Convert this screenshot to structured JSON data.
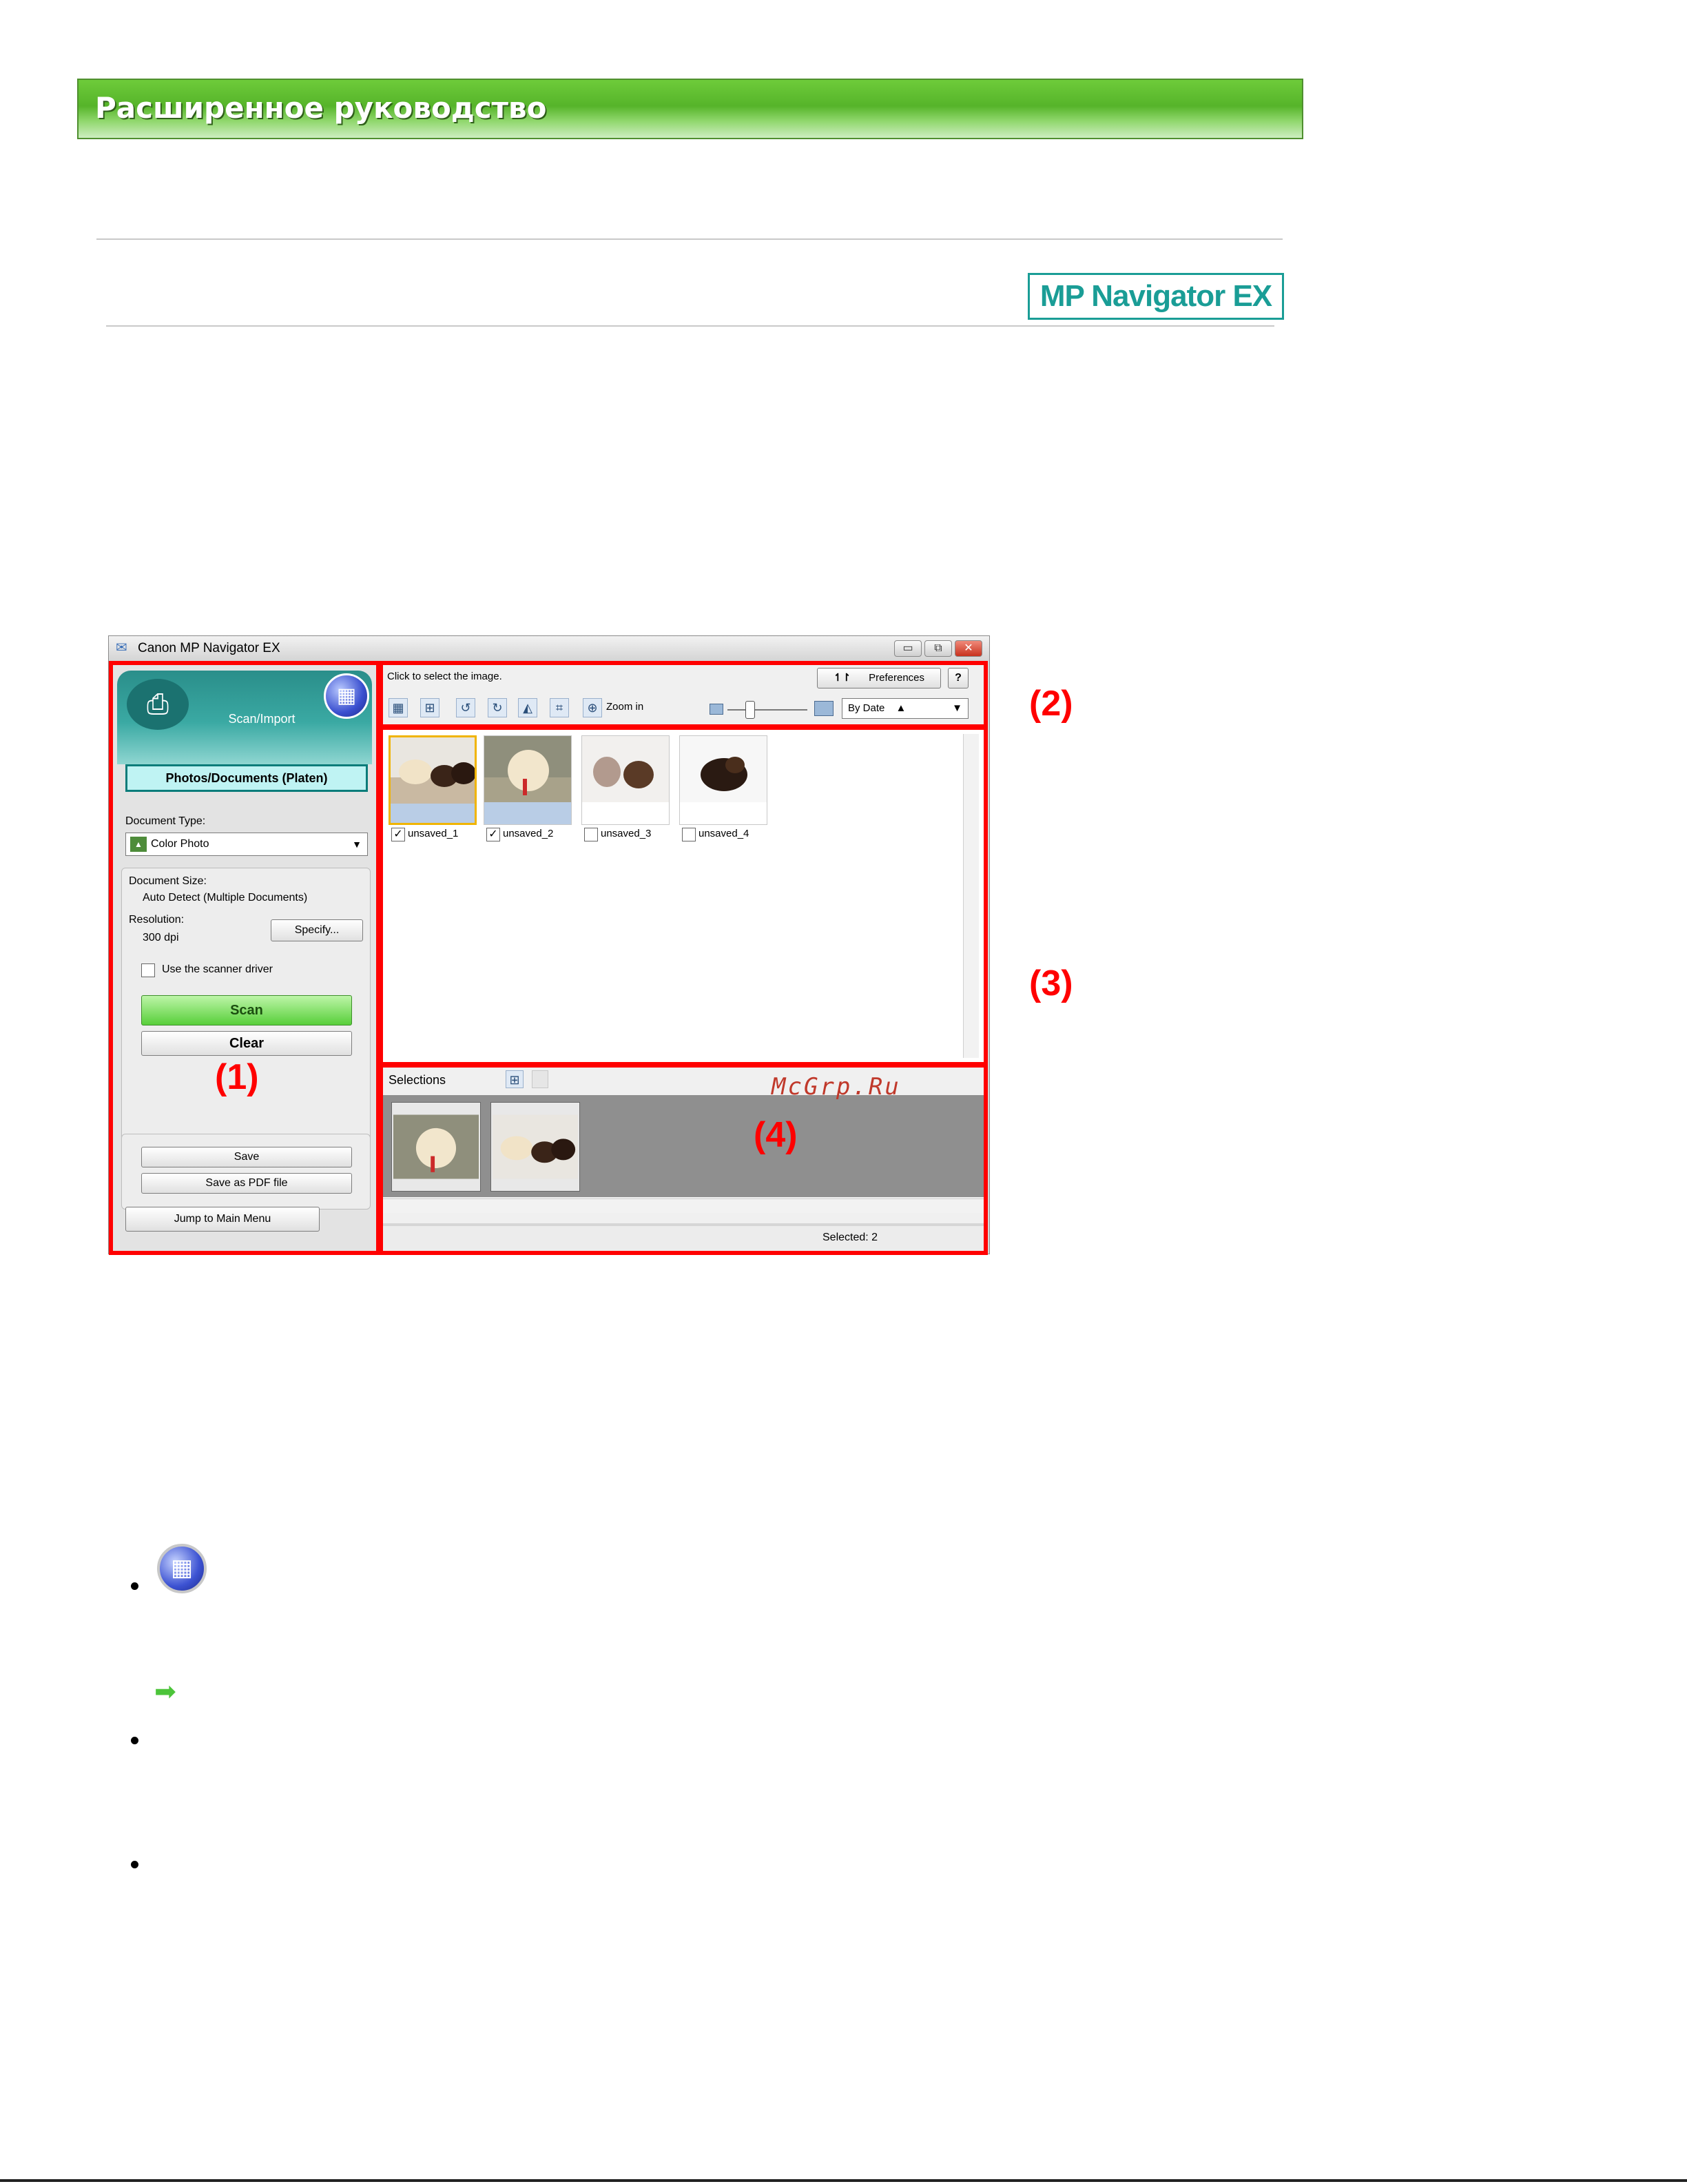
{
  "header": {
    "title": "Расширенное руководство"
  },
  "logo": {
    "text": "MP Navigator EX"
  },
  "window": {
    "title": "Canon MP Navigator EX",
    "controls": {
      "minimize": "▭",
      "restore": "⧉",
      "close": "✕"
    },
    "left_panel": {
      "mode_label": "Scan/Import",
      "source_button": "Photos/Documents (Platen)",
      "document_type_label": "Document Type:",
      "document_type_value": "Color Photo",
      "document_size_label": "Document Size:",
      "document_size_value": "Auto Detect (Multiple Documents)",
      "resolution_label": "Resolution:",
      "resolution_value": "300 dpi",
      "specify_button": "Specify...",
      "scanner_driver_label": "Use the scanner driver",
      "scan_button": "Scan",
      "clear_button": "Clear",
      "save_button": "Save",
      "save_pdf_button": "Save as PDF file",
      "main_menu_button": "Jump to Main Menu"
    },
    "toolbar": {
      "hint": "Click to select the image.",
      "preferences_button": "Preferences",
      "help_button": "?",
      "zoom_label": "Zoom in",
      "sort_value": "By Date"
    },
    "thumbnails": [
      {
        "label": "unsaved_1",
        "checked": true,
        "selected": true
      },
      {
        "label": "unsaved_2",
        "checked": true,
        "selected": false
      },
      {
        "label": "unsaved_3",
        "checked": false,
        "selected": false
      },
      {
        "label": "unsaved_4",
        "checked": false,
        "selected": false
      }
    ],
    "selections": {
      "label": "Selections",
      "status": "Selected: 2"
    },
    "callouts": {
      "c1": "(1)",
      "c2": "(2)",
      "c3": "(3)",
      "c4": "(4)"
    }
  },
  "watermark": "McGrp.Ru"
}
